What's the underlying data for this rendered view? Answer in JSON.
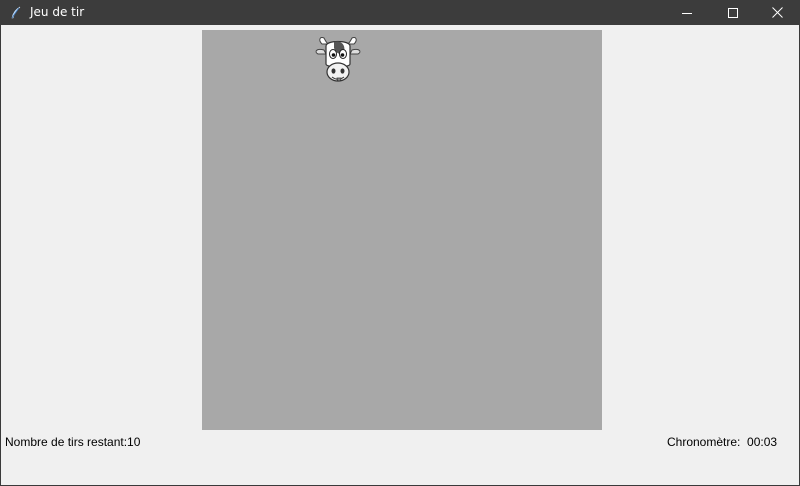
{
  "window": {
    "title": "Jeu de tir",
    "icon": "feather-icon",
    "controls": [
      "minimize-icon",
      "maximize-icon",
      "close-icon"
    ]
  },
  "game": {
    "canvas_color": "#a8a8a8",
    "target": "cow-head-target"
  },
  "status": {
    "shots_remaining": "Nombre de tirs restant:10",
    "chrono_label": "Chronomètre:",
    "chrono_value": "00:03"
  },
  "colors": {
    "titlebar": "#3c3c3c",
    "background": "#f0f0f0"
  }
}
